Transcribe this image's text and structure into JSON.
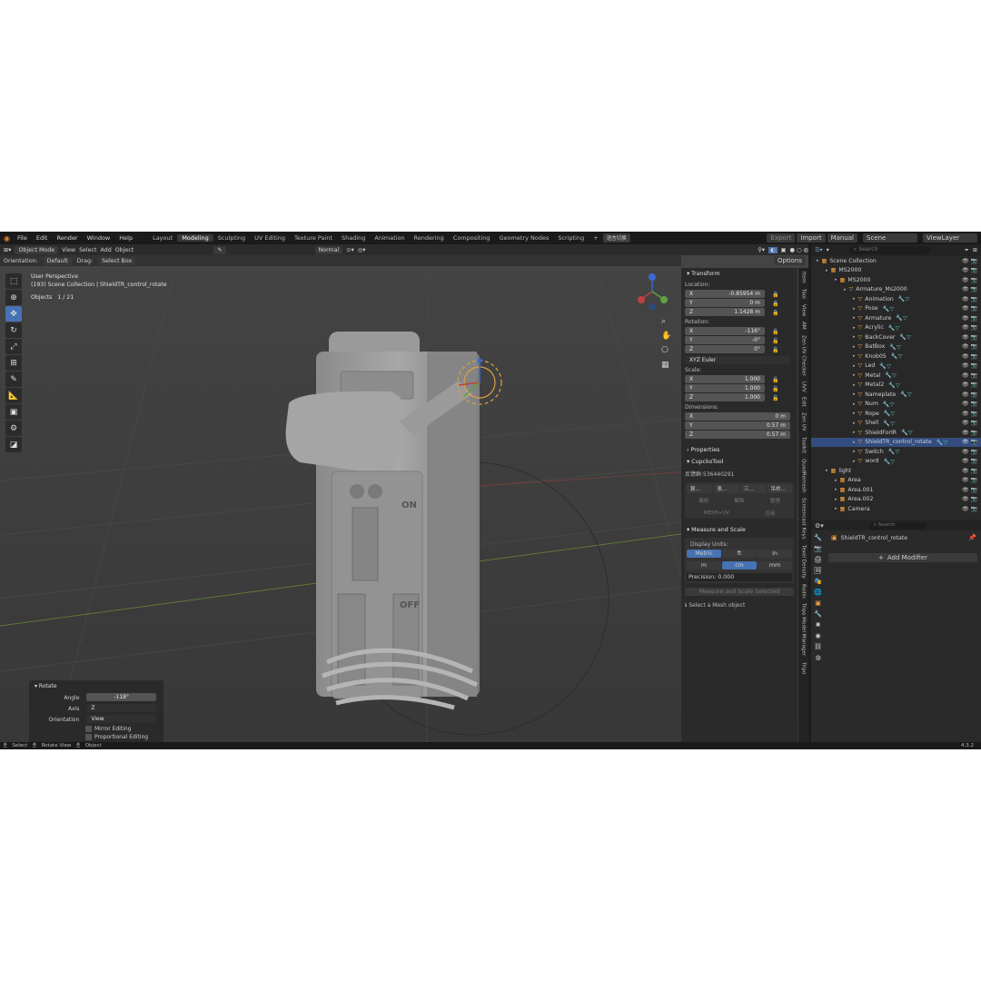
{
  "menu": {
    "items": [
      "File",
      "Edit",
      "Render",
      "Window",
      "Help"
    ],
    "workspaces": [
      "Layout",
      "Modeling",
      "Sculpting",
      "UV Editing",
      "Texture Paint",
      "Shading",
      "Animation",
      "Rendering",
      "Compositing",
      "Geometry Nodes",
      "Scripting"
    ],
    "active_workspace": "Modeling",
    "cjk_button": "语言切换",
    "export": "Export",
    "import": "Import",
    "manual": "Manual",
    "scene": "Scene",
    "viewlayer": "ViewLayer"
  },
  "viewport_header": {
    "mode": "Object Mode",
    "menus": [
      "View",
      "Select",
      "Add",
      "Object"
    ],
    "normal": "Normal",
    "options": "Options"
  },
  "viewport_sub": {
    "orientation_label": "Orientation:",
    "orientation_value": "Default",
    "drag_label": "Drag:",
    "drag_value": "Select Box"
  },
  "overlay_text": {
    "perspective": "User Perspective",
    "collection": "(193) Scene Collection | ShieldTR_control_rotate",
    "objects_label": "Objects",
    "objects_value": "1 / 21"
  },
  "transform": {
    "title": "Transform",
    "location_label": "Location:",
    "location": [
      {
        "axis": "X",
        "value": "-0.85954 m"
      },
      {
        "axis": "Y",
        "value": "0 m"
      },
      {
        "axis": "Z",
        "value": "1.1428 m"
      }
    ],
    "rotation_label": "Rotation:",
    "rotation": [
      {
        "axis": "X",
        "value": "-116°"
      },
      {
        "axis": "Y",
        "value": "-0°"
      },
      {
        "axis": "Z",
        "value": "0°"
      }
    ],
    "euler": "XYZ Euler",
    "scale_label": "Scale:",
    "scale": [
      {
        "axis": "X",
        "value": "1.000"
      },
      {
        "axis": "Y",
        "value": "1.000"
      },
      {
        "axis": "Z",
        "value": "1.000"
      }
    ],
    "dimensions_label": "Dimensions:",
    "dimensions": [
      {
        "axis": "X",
        "value": "0 m"
      },
      {
        "axis": "Y",
        "value": "0.57 m"
      },
      {
        "axis": "Z",
        "value": "0.57 m"
      }
    ]
  },
  "npanel_sections": {
    "properties": "Properties",
    "cupcko": "CupckoTool",
    "cupcko_id": "反馈群:536440291",
    "cupcko_buttons": [
      "算...",
      "表...",
      "三...",
      "吊桥..."
    ],
    "cupcko_row2": [
      "编组",
      "解除",
      "整理"
    ],
    "cupcko_row3": [
      "MESH+UV",
      "应用"
    ],
    "measure": "Measure and Scale",
    "display_units": "Display Units:",
    "units1": [
      "Metric",
      "ft",
      "in"
    ],
    "units2": [
      "m",
      "cm",
      "mm"
    ],
    "precision_label": "Precision:",
    "precision_value": "0.000",
    "measure_btn": "Measure and Scale Selected",
    "hint": "Select a Mesh object"
  },
  "vertical_tabs": [
    "Item",
    "Tool",
    "View",
    "AM",
    "Zen UV Checker",
    "UVV",
    "Edit",
    "Zen UV",
    "Toolkit",
    "QuadRemesh",
    "Screencast Keys",
    "Texel Density",
    "Rodin",
    "Tripo Model Manager",
    "Tripo"
  ],
  "outliner": {
    "search_placeholder": "Search",
    "rows": [
      {
        "name": "Scene Collection",
        "indent": 0
      },
      {
        "name": "MS2000",
        "indent": 1
      },
      {
        "name": "MS2000",
        "indent": 2
      },
      {
        "name": "Armature_Ms2000",
        "indent": 3
      },
      {
        "name": "Animation",
        "indent": 4
      },
      {
        "name": "Pose",
        "indent": 4
      },
      {
        "name": "Armature",
        "indent": 4
      },
      {
        "name": "Acrylic",
        "indent": 4
      },
      {
        "name": "BackCover",
        "indent": 4
      },
      {
        "name": "BatBox",
        "indent": 4
      },
      {
        "name": "Knob05",
        "indent": 4
      },
      {
        "name": "Led",
        "indent": 4
      },
      {
        "name": "Metal",
        "indent": 4
      },
      {
        "name": "Metal2",
        "indent": 4
      },
      {
        "name": "Nameplate",
        "indent": 4
      },
      {
        "name": "Num",
        "indent": 4
      },
      {
        "name": "Rope",
        "indent": 4
      },
      {
        "name": "Shell",
        "indent": 4
      },
      {
        "name": "ShieldForIR",
        "indent": 4
      },
      {
        "name": "ShieldTR_control_rotate",
        "indent": 4,
        "selected": true
      },
      {
        "name": "Switch",
        "indent": 4
      },
      {
        "name": "word",
        "indent": 4
      },
      {
        "name": "light",
        "indent": 1
      },
      {
        "name": "Area",
        "indent": 2
      },
      {
        "name": "Area.001",
        "indent": 2
      },
      {
        "name": "Area.002",
        "indent": 2
      },
      {
        "name": "Camera",
        "indent": 2
      }
    ]
  },
  "properties": {
    "search_placeholder": "Search",
    "object": "ShieldTR_control_rotate",
    "add_modifier": "Add Modifier"
  },
  "rotate_panel": {
    "title": "Rotate",
    "angle_label": "Angle",
    "angle_value": "-118°",
    "axis_label": "Axis",
    "axis_value": "Z",
    "orientation_label": "Orientation",
    "orientation_value": "View",
    "mirror": "Mirror Editing",
    "proportional": "Proportional Editing"
  },
  "status": {
    "select": "Select",
    "rotate": "Rotate View",
    "object": "Object",
    "version": "4.3.2"
  },
  "device_text": {
    "on": "ON",
    "off": "OFF"
  }
}
